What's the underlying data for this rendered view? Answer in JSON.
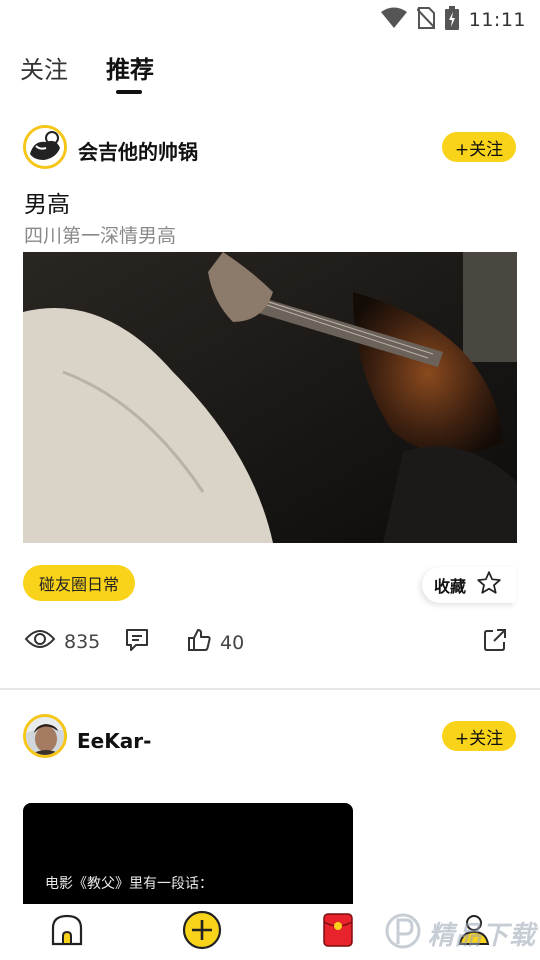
{
  "status_bar": {
    "time": "11:11",
    "icons": [
      "wifi-icon",
      "no-sim-icon",
      "battery-charging-icon"
    ]
  },
  "tabs": [
    {
      "label": "关注",
      "active": false
    },
    {
      "label": "推荐",
      "active": true
    }
  ],
  "posts": [
    {
      "author": "会吉他的帅锅",
      "follow_label": "+关注",
      "title": "男高",
      "description": "四川第一深情男高",
      "media": "guitar-photo",
      "topic_tag": "碰友圈日常",
      "collect_label": "收藏",
      "views": "835",
      "likes": "40"
    },
    {
      "author": "EeKar-",
      "follow_label": "+关注",
      "video_caption": "电影《教父》里有一段话："
    }
  ],
  "bottom_nav": [
    "home-icon",
    "add-post-icon",
    "red-envelope-icon",
    "profile-icon"
  ],
  "watermark": {
    "text": "精品下载"
  },
  "colors": {
    "accent": "#f9d21a",
    "divider": "#e6e6e6",
    "muted_text": "#8a8a8a"
  }
}
